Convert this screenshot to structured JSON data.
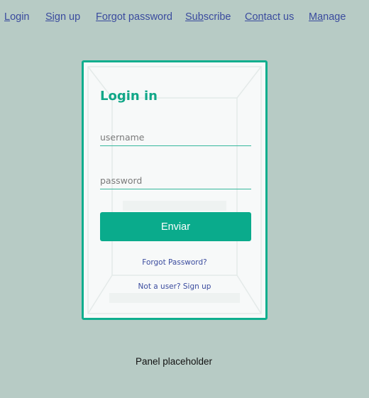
{
  "nav": {
    "items": [
      {
        "key": "L",
        "rest": "ogin"
      },
      {
        "key": "Sig",
        "rest": "n up"
      },
      {
        "key": "For",
        "rest": "got password"
      },
      {
        "key": "Sub",
        "rest": "scribe"
      },
      {
        "key": "Con",
        "rest": "tact us"
      },
      {
        "key": "Ma",
        "rest": "nage"
      }
    ]
  },
  "login": {
    "title": "Login in",
    "username_placeholder": "username",
    "password_placeholder": "password",
    "submit_label": "Enviar",
    "forgot_label": "Forgot Password?",
    "signup_label": "Not a user? Sign up"
  },
  "panel": {
    "placeholder": "Panel placeholder"
  },
  "colors": {
    "background": "#b7cbc5",
    "accent": "#0fae8e",
    "link": "#3a4b9e"
  }
}
